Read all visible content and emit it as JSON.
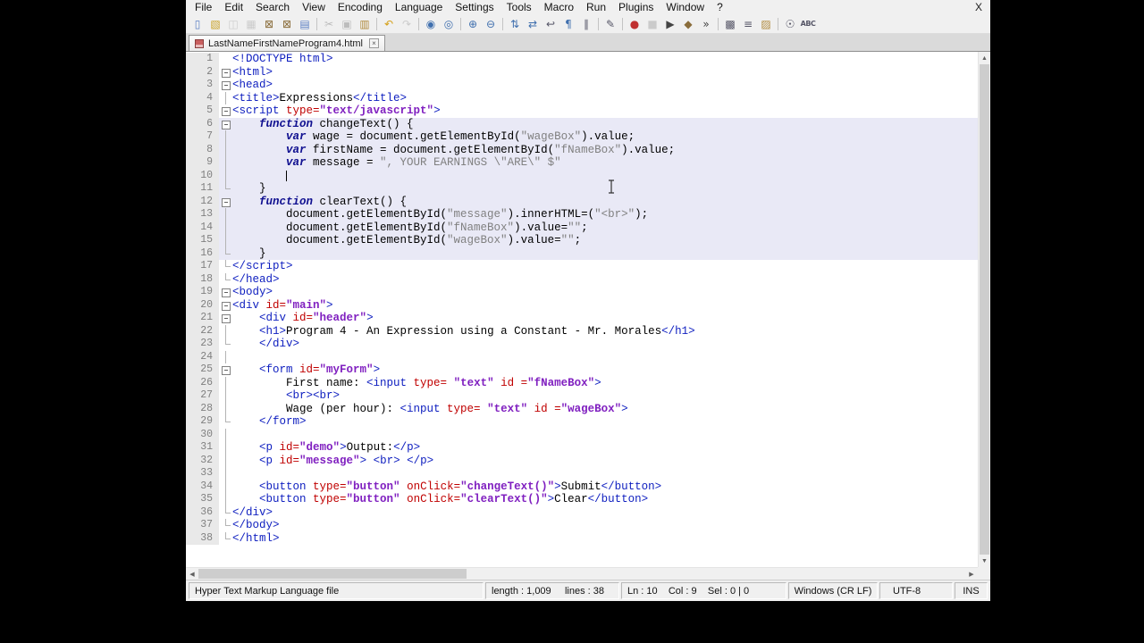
{
  "window": {
    "close_label": "X"
  },
  "menu": {
    "items": [
      {
        "id": "file",
        "label": "File"
      },
      {
        "id": "edit",
        "label": "Edit"
      },
      {
        "id": "search",
        "label": "Search"
      },
      {
        "id": "view",
        "label": "View"
      },
      {
        "id": "encoding",
        "label": "Encoding"
      },
      {
        "id": "language",
        "label": "Language"
      },
      {
        "id": "settings",
        "label": "Settings"
      },
      {
        "id": "tools",
        "label": "Tools"
      },
      {
        "id": "macro",
        "label": "Macro"
      },
      {
        "id": "run",
        "label": "Run"
      },
      {
        "id": "plugins",
        "label": "Plugins"
      },
      {
        "id": "window",
        "label": "Window"
      },
      {
        "id": "help",
        "label": "?"
      }
    ]
  },
  "toolbar": {
    "icons": [
      {
        "name": "new-file",
        "glyph": "▯",
        "color": "#5b7fc4"
      },
      {
        "name": "open-file",
        "glyph": "▧",
        "color": "#c9a227"
      },
      {
        "name": "save",
        "glyph": "◫",
        "color": "#9a9a9a",
        "dis": true
      },
      {
        "name": "save-all",
        "glyph": "▦",
        "color": "#9a9a9a",
        "dis": true
      },
      {
        "name": "close",
        "glyph": "⊠",
        "color": "#8a6d3b"
      },
      {
        "name": "close-all",
        "glyph": "⊠",
        "color": "#8a6d3b"
      },
      {
        "name": "print",
        "glyph": "▤",
        "color": "#5b7fc4"
      },
      {
        "sep": true
      },
      {
        "name": "cut",
        "glyph": "✂",
        "color": "#777777",
        "dis": true
      },
      {
        "name": "copy",
        "glyph": "▣",
        "color": "#777777",
        "dis": true
      },
      {
        "name": "paste",
        "glyph": "▥",
        "color": "#b08a3e"
      },
      {
        "sep": true
      },
      {
        "name": "undo",
        "glyph": "↶",
        "color": "#d4a017"
      },
      {
        "name": "redo",
        "glyph": "↷",
        "color": "#999999",
        "dis": true
      },
      {
        "sep": true
      },
      {
        "name": "find",
        "glyph": "◉",
        "color": "#3f6fae"
      },
      {
        "name": "replace",
        "glyph": "◎",
        "color": "#3f6fae"
      },
      {
        "sep": true
      },
      {
        "name": "zoom-in",
        "glyph": "⊕",
        "color": "#3f6fae"
      },
      {
        "name": "zoom-out",
        "glyph": "⊖",
        "color": "#3f6fae"
      },
      {
        "sep": true
      },
      {
        "name": "sync-vertical",
        "glyph": "⇅",
        "color": "#3f6fae"
      },
      {
        "name": "sync-horizontal",
        "glyph": "⇄",
        "color": "#3f6fae"
      },
      {
        "name": "word-wrap",
        "glyph": "↩",
        "color": "#555566"
      },
      {
        "name": "show-all-characters",
        "glyph": "¶",
        "color": "#3f6fae"
      },
      {
        "name": "indent-guide",
        "glyph": "∥",
        "color": "#555566"
      },
      {
        "sep": true
      },
      {
        "name": "user-defined-dialog",
        "glyph": "✎",
        "color": "#555566"
      },
      {
        "sep": true
      },
      {
        "name": "macro-record",
        "glyph": "●",
        "color": "#c03030"
      },
      {
        "name": "macro-stop",
        "glyph": "■",
        "color": "#999999",
        "dis": true
      },
      {
        "name": "macro-play",
        "glyph": "▶",
        "color": "#444444"
      },
      {
        "name": "macro-save",
        "glyph": "◆",
        "color": "#8a6d3b"
      },
      {
        "name": "macro-run-multiple",
        "glyph": "»",
        "color": "#444444"
      },
      {
        "sep": true
      },
      {
        "name": "document-map",
        "glyph": "▩",
        "color": "#555566"
      },
      {
        "name": "document-list",
        "glyph": "≡",
        "color": "#555566"
      },
      {
        "name": "folder-as-workspace",
        "glyph": "▨",
        "color": "#b08a3e"
      },
      {
        "sep": true
      },
      {
        "name": "monitoring",
        "glyph": "☉",
        "color": "#555566"
      },
      {
        "name": "spell-check",
        "glyph": "ABC",
        "color": "#555566",
        "text": true
      }
    ]
  },
  "tab": {
    "title": "LastNameFirstNameProgram4.html",
    "close_glyph": "×"
  },
  "icons": {
    "up": "▲",
    "down": "▼",
    "left": "◀",
    "right": "▶"
  },
  "colors": {
    "tag": "#1020c0",
    "attr": "#c00000",
    "val": "#8020c0",
    "kw": "#101090",
    "str": "#808080",
    "js_bg": "#e9e9f6",
    "gutter_bg": "#e9e9e9",
    "gutter_fg": "#808080"
  },
  "editor": {
    "caret": {
      "line": 10,
      "col": 9
    },
    "lines": [
      {
        "n": 1,
        "f": "n",
        "s": false,
        "g": [
          [
            "<!DOCTYPE html>",
            "tag"
          ]
        ]
      },
      {
        "n": 2,
        "f": "b",
        "s": false,
        "g": [
          [
            "<html>",
            "tag"
          ]
        ]
      },
      {
        "n": 3,
        "f": "b",
        "s": false,
        "g": [
          [
            "<head>",
            "tag"
          ]
        ]
      },
      {
        "n": 4,
        "f": "c",
        "s": false,
        "g": [
          [
            "<title>",
            "tag"
          ],
          [
            "Expressions",
            "txt"
          ],
          [
            "</title>",
            "tag"
          ]
        ]
      },
      {
        "n": 5,
        "f": "b",
        "s": false,
        "g": [
          [
            "<script ",
            "tag"
          ],
          [
            "type=",
            "attr"
          ],
          [
            "\"text/javascript\"",
            "val"
          ],
          [
            ">",
            "tag"
          ]
        ]
      },
      {
        "n": 6,
        "f": "b",
        "s": true,
        "g": [
          [
            "    ",
            "txt"
          ],
          [
            "function",
            "kw"
          ],
          [
            " changeText() {",
            "txt"
          ]
        ]
      },
      {
        "n": 7,
        "f": "c",
        "s": true,
        "g": [
          [
            "        ",
            "txt"
          ],
          [
            "var",
            "kw"
          ],
          [
            " wage = document.getElementById(",
            "txt"
          ],
          [
            "\"wageBox\"",
            "str"
          ],
          [
            ").value;",
            "txt"
          ]
        ]
      },
      {
        "n": 8,
        "f": "c",
        "s": true,
        "g": [
          [
            "        ",
            "txt"
          ],
          [
            "var",
            "kw"
          ],
          [
            " firstName = document.getElementById(",
            "txt"
          ],
          [
            "\"fNameBox\"",
            "str"
          ],
          [
            ").value;",
            "txt"
          ]
        ]
      },
      {
        "n": 9,
        "f": "c",
        "s": true,
        "g": [
          [
            "        ",
            "txt"
          ],
          [
            "var",
            "kw"
          ],
          [
            " message = ",
            "txt"
          ],
          [
            "\", YOUR EARNINGS \\\"ARE\\\" $\"",
            "str"
          ]
        ]
      },
      {
        "n": 10,
        "f": "c",
        "s": true,
        "g": [
          [
            "        ",
            "txt"
          ]
        ]
      },
      {
        "n": 11,
        "f": "e",
        "s": true,
        "g": [
          [
            "    }",
            "txt"
          ]
        ]
      },
      {
        "n": 12,
        "f": "b",
        "s": true,
        "g": [
          [
            "    ",
            "txt"
          ],
          [
            "function",
            "kw"
          ],
          [
            " clearText() {",
            "txt"
          ]
        ]
      },
      {
        "n": 13,
        "f": "c",
        "s": true,
        "g": [
          [
            "        document.getElementById(",
            "txt"
          ],
          [
            "\"message\"",
            "str"
          ],
          [
            ").innerHTML=(",
            "txt"
          ],
          [
            "\"<br>\"",
            "str"
          ],
          [
            ");",
            "txt"
          ]
        ]
      },
      {
        "n": 14,
        "f": "c",
        "s": true,
        "g": [
          [
            "        document.getElementById(",
            "txt"
          ],
          [
            "\"fNameBox\"",
            "str"
          ],
          [
            ").value=",
            "txt"
          ],
          [
            "\"\"",
            "str"
          ],
          [
            ";",
            "txt"
          ]
        ]
      },
      {
        "n": 15,
        "f": "c",
        "s": true,
        "g": [
          [
            "        document.getElementById(",
            "txt"
          ],
          [
            "\"wageBox\"",
            "str"
          ],
          [
            ").value=",
            "txt"
          ],
          [
            "\"\"",
            "str"
          ],
          [
            ";",
            "txt"
          ]
        ]
      },
      {
        "n": 16,
        "f": "e",
        "s": true,
        "g": [
          [
            "    }",
            "txt"
          ]
        ]
      },
      {
        "n": 17,
        "f": "e",
        "s": false,
        "g": [
          [
            "</script>",
            "tag"
          ]
        ]
      },
      {
        "n": 18,
        "f": "e",
        "s": false,
        "g": [
          [
            "</head>",
            "tag"
          ]
        ]
      },
      {
        "n": 19,
        "f": "b",
        "s": false,
        "g": [
          [
            "<body>",
            "tag"
          ]
        ]
      },
      {
        "n": 20,
        "f": "b",
        "s": false,
        "g": [
          [
            "<div ",
            "tag"
          ],
          [
            "id=",
            "attr"
          ],
          [
            "\"main\"",
            "val"
          ],
          [
            ">",
            "tag"
          ]
        ]
      },
      {
        "n": 21,
        "f": "b",
        "s": false,
        "g": [
          [
            "    ",
            "txt"
          ],
          [
            "<div ",
            "tag"
          ],
          [
            "id=",
            "attr"
          ],
          [
            "\"header\"",
            "val"
          ],
          [
            ">",
            "tag"
          ]
        ]
      },
      {
        "n": 22,
        "f": "c",
        "s": false,
        "g": [
          [
            "    ",
            "txt"
          ],
          [
            "<h1>",
            "tag"
          ],
          [
            "Program 4 - An Expression using a Constant - Mr. Morales",
            "txt"
          ],
          [
            "</h1>",
            "tag"
          ]
        ]
      },
      {
        "n": 23,
        "f": "e",
        "s": false,
        "g": [
          [
            "    ",
            "txt"
          ],
          [
            "</div>",
            "tag"
          ]
        ]
      },
      {
        "n": 24,
        "f": "c",
        "s": false,
        "g": []
      },
      {
        "n": 25,
        "f": "b",
        "s": false,
        "g": [
          [
            "    ",
            "txt"
          ],
          [
            "<form ",
            "tag"
          ],
          [
            "id=",
            "attr"
          ],
          [
            "\"myForm\"",
            "val"
          ],
          [
            ">",
            "tag"
          ]
        ]
      },
      {
        "n": 26,
        "f": "c",
        "s": false,
        "g": [
          [
            "        First name: ",
            "txt"
          ],
          [
            "<input ",
            "tag"
          ],
          [
            "type= ",
            "attr"
          ],
          [
            "\"text\"",
            "val"
          ],
          [
            " ",
            "txt"
          ],
          [
            "id =",
            "attr"
          ],
          [
            "\"fNameBox\"",
            "val"
          ],
          [
            ">",
            "tag"
          ]
        ]
      },
      {
        "n": 27,
        "f": "c",
        "s": false,
        "g": [
          [
            "        ",
            "txt"
          ],
          [
            "<br><br>",
            "tag"
          ]
        ]
      },
      {
        "n": 28,
        "f": "c",
        "s": false,
        "g": [
          [
            "        Wage (per hour): ",
            "txt"
          ],
          [
            "<input ",
            "tag"
          ],
          [
            "type= ",
            "attr"
          ],
          [
            "\"text\"",
            "val"
          ],
          [
            " ",
            "txt"
          ],
          [
            "id =",
            "attr"
          ],
          [
            "\"wageBox\"",
            "val"
          ],
          [
            ">",
            "tag"
          ]
        ]
      },
      {
        "n": 29,
        "f": "e",
        "s": false,
        "g": [
          [
            "    ",
            "txt"
          ],
          [
            "</form>",
            "tag"
          ]
        ]
      },
      {
        "n": 30,
        "f": "c",
        "s": false,
        "g": []
      },
      {
        "n": 31,
        "f": "c",
        "s": false,
        "g": [
          [
            "    ",
            "txt"
          ],
          [
            "<p ",
            "tag"
          ],
          [
            "id=",
            "attr"
          ],
          [
            "\"demo\"",
            "val"
          ],
          [
            ">",
            "tag"
          ],
          [
            "Output:",
            "txt"
          ],
          [
            "</p>",
            "tag"
          ]
        ]
      },
      {
        "n": 32,
        "f": "c",
        "s": false,
        "g": [
          [
            "    ",
            "txt"
          ],
          [
            "<p ",
            "tag"
          ],
          [
            "id=",
            "attr"
          ],
          [
            "\"message\"",
            "val"
          ],
          [
            ">",
            "tag"
          ],
          [
            " ",
            "txt"
          ],
          [
            "<br>",
            "tag"
          ],
          [
            " ",
            "txt"
          ],
          [
            "</p>",
            "tag"
          ]
        ]
      },
      {
        "n": 33,
        "f": "c",
        "s": false,
        "g": []
      },
      {
        "n": 34,
        "f": "c",
        "s": false,
        "g": [
          [
            "    ",
            "txt"
          ],
          [
            "<button ",
            "tag"
          ],
          [
            "type=",
            "attr"
          ],
          [
            "\"button\"",
            "val"
          ],
          [
            " ",
            "txt"
          ],
          [
            "onClick=",
            "attr"
          ],
          [
            "\"changeText()\"",
            "val"
          ],
          [
            ">",
            "tag"
          ],
          [
            "Submit",
            "txt"
          ],
          [
            "</button>",
            "tag"
          ]
        ]
      },
      {
        "n": 35,
        "f": "c",
        "s": false,
        "g": [
          [
            "    ",
            "txt"
          ],
          [
            "<button ",
            "tag"
          ],
          [
            "type=",
            "attr"
          ],
          [
            "\"button\"",
            "val"
          ],
          [
            " ",
            "txt"
          ],
          [
            "onClick=",
            "attr"
          ],
          [
            "\"clearText()\"",
            "val"
          ],
          [
            ">",
            "tag"
          ],
          [
            "Clear",
            "txt"
          ],
          [
            "</button>",
            "tag"
          ]
        ]
      },
      {
        "n": 36,
        "f": "e",
        "s": false,
        "g": [
          [
            "</div>",
            "tag"
          ]
        ]
      },
      {
        "n": 37,
        "f": "e",
        "s": false,
        "g": [
          [
            "</body>",
            "tag"
          ]
        ]
      },
      {
        "n": 38,
        "f": "e",
        "s": false,
        "g": [
          [
            "</html>",
            "tag"
          ]
        ]
      }
    ]
  },
  "statusbar": {
    "doc_type": "Hyper Text Markup Language file",
    "length_lines": "length : 1,009     lines : 38",
    "position": "Ln : 10    Col : 9    Sel : 0 | 0",
    "eol": "Windows (CR LF)",
    "encoding": "UTF-8",
    "mode": "INS"
  }
}
